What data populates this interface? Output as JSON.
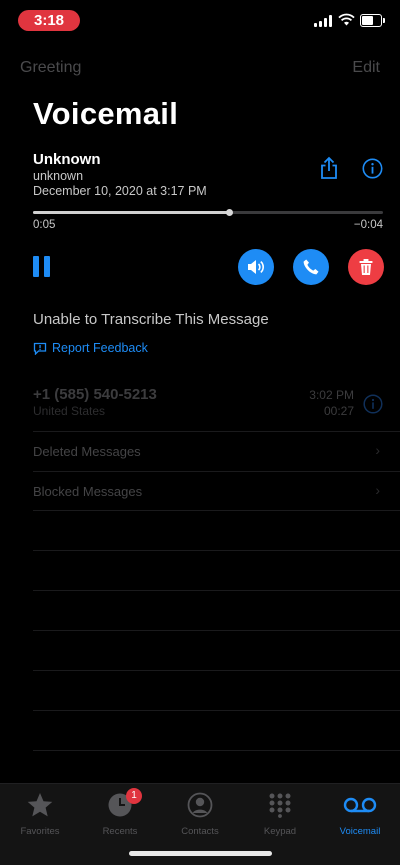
{
  "status_bar": {
    "time": "3:18"
  },
  "nav": {
    "left_label": "Greeting",
    "right_label": "Edit"
  },
  "page_title": "Voicemail",
  "voicemail": {
    "name": "Unknown",
    "subtitle": "unknown",
    "date": "December 10, 2020 at 3:17 PM",
    "elapsed": "0:05",
    "remaining": "−0:04",
    "progress_fraction": 0.56
  },
  "transcription": {
    "message": "Unable to Transcribe This Message",
    "feedback_label": "Report Feedback"
  },
  "recent_voicemail": {
    "number": "+1 (585) 540-5213",
    "country": "United States",
    "time": "3:02 PM",
    "duration": "00:27"
  },
  "folders": [
    {
      "label": "Deleted Messages"
    },
    {
      "label": "Blocked Messages"
    }
  ],
  "tabs": [
    {
      "label": "Favorites",
      "icon": "star-icon"
    },
    {
      "label": "Recents",
      "icon": "clock-icon",
      "badge": "1"
    },
    {
      "label": "Contacts",
      "icon": "person-circle-icon"
    },
    {
      "label": "Keypad",
      "icon": "keypad-icon"
    },
    {
      "label": "Voicemail",
      "icon": "voicemail-icon",
      "active": true
    }
  ],
  "colors": {
    "accent": "#1e8cf5",
    "delete": "#ee3d43",
    "badge": "#e0353f",
    "background": "#000000"
  }
}
